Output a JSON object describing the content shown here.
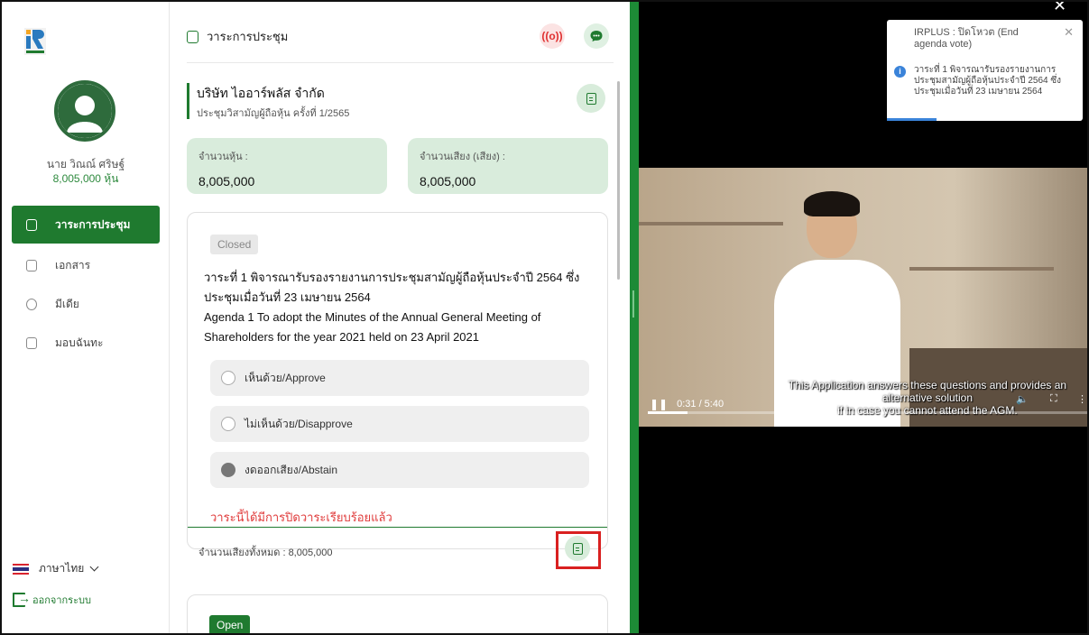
{
  "sidebar": {
    "user_name": "นาย วิณณ์ ศริษฐ์",
    "user_shares": "8,005,000 หุ้น",
    "items": [
      {
        "label": "วาระการประชุม",
        "icon": "agenda-icon"
      },
      {
        "label": "เอกสาร",
        "icon": "document-icon"
      },
      {
        "label": "มีเดีย",
        "icon": "media-icon"
      },
      {
        "label": "มอบฉันทะ",
        "icon": "proxy-icon"
      }
    ],
    "language": "ภาษาไทย",
    "logout": "ออกจากระบบ"
  },
  "main": {
    "title": "วาระการประชุม",
    "live_label": "((o))",
    "company_name": "บริษัท ไออาร์พลัส จำกัด",
    "meeting_name": "ประชุมวิสามัญผู้ถือหุ้น ครั้งที่ 1/2565",
    "stats": [
      {
        "label": "จำนวนหุ้น :",
        "value": "8,005,000"
      },
      {
        "label": "จำนวนเสียง (เสียง) :",
        "value": "8,005,000"
      }
    ],
    "agenda": {
      "status": "Closed",
      "text_th": "วาระที่ 1 พิจารณารับรองรายงานการประชุมสามัญผู้ถือหุ้นประจำปี 2564 ซึ่งประชุมเมื่อวันที่ 23 เมษายน 2564",
      "text_en": "Agenda 1 To adopt the Minutes of the Annual General Meeting of Shareholders for the year 2021 held on 23 April 2021",
      "options": [
        "เห็นด้วย/Approve",
        "ไม่เห็นด้วย/Disapprove",
        "งดออกเสียง/Abstain"
      ],
      "selected_option": 2,
      "closed_message": "วาระนี้ได้มีการปิดวาระเรียบร้อยแล้ว",
      "total_votes": "จำนวนเสียงทั้งหมด : 8,005,000"
    },
    "next_agenda_status": "Open"
  },
  "video": {
    "time": "0:31 / 5:40",
    "progress": 0.091,
    "subtitle_line1": "This Application answers these questions and provides an alternative solution",
    "subtitle_line2": "if in case you cannot attend the AGM."
  },
  "toast": {
    "title": "IRPLUS : ปิดโหวต (End agenda vote)",
    "message": "วาระที่ 1 พิจารณารับรองรายงานการประชุมสามัญผู้ถือหุ้นประจำปี 2564 ซึ่งประชุมเมื่อวันที่ 23 เมษายน 2564"
  },
  "colors": {
    "brand_green": "#1f7a2f",
    "card_green": "#d9ecdc",
    "alert_red": "#e03c3c",
    "info_blue": "#3a83d9"
  }
}
